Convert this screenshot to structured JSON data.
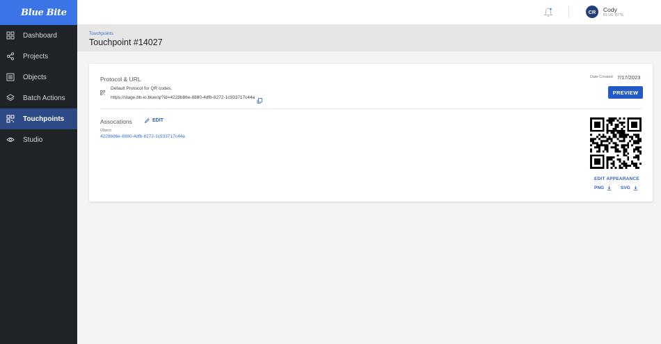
{
  "brand": {
    "logo_text": "Blue Bite",
    "accent": "#3a74e6"
  },
  "sidebar": {
    "items": [
      {
        "label": "Dashboard",
        "icon": "grid-icon"
      },
      {
        "label": "Projects",
        "icon": "share-icon"
      },
      {
        "label": "Objects",
        "icon": "box-icon"
      },
      {
        "label": "Batch Actions",
        "icon": "layers-icon"
      },
      {
        "label": "Touchpoints",
        "icon": "qr-icon",
        "active": true
      },
      {
        "label": "Studio",
        "icon": "eye-icon"
      }
    ]
  },
  "header": {
    "user_initials": "CR",
    "user_name": "Cody",
    "user_org": "BLUE BITE"
  },
  "page": {
    "breadcrumb": "Touchpoints",
    "title": "Touchpoint #14027"
  },
  "card": {
    "protocol_title": "Protocol & URL",
    "protocol_desc": "Default Protocol for QR codes.",
    "url": "https://stage.bb-io.blue/q/?id=4228b86e-8880-4dfb-8272-1c933717c44a",
    "assoc_title": "Assocations",
    "edit_label": "EDIT",
    "object_label": "Object",
    "object_id": "4228b86e-8880-4dfb-8272-1c933717c44a",
    "date_created_label": "Date Created",
    "date_created": "7/17/2023",
    "preview_label": "PREVIEW",
    "edit_appearance_label": "EDIT APPEARANCE",
    "png_label": "PNG",
    "svg_label": "SVG"
  }
}
